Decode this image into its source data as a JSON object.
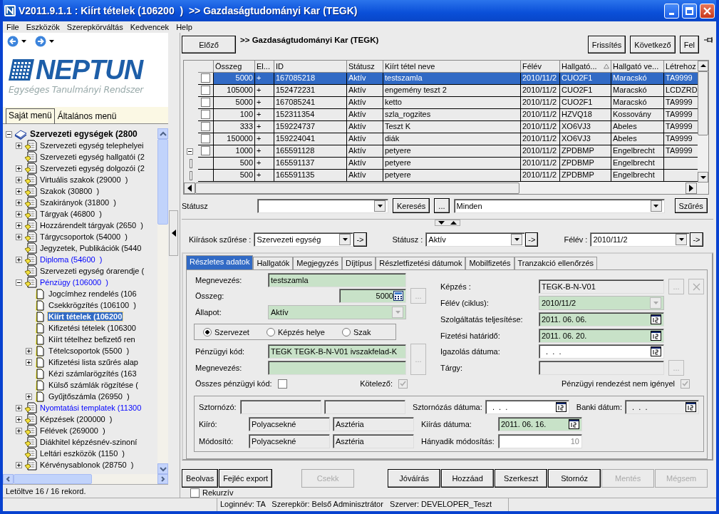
{
  "window": {
    "title": "V2011.9.1.1 : Kiírt tételek (106200  )  >> Gazdaságtudományi Kar (TEGK)"
  },
  "menu": [
    "File",
    "Eszközök",
    "Szerepkörváltás",
    "Kedvencek",
    "Help"
  ],
  "logo": {
    "name": "NEPTUN",
    "subtitle": "Egységes Tanulmányi Rendszer"
  },
  "side_tabs": [
    {
      "label": "Saját menü",
      "selected": true
    },
    {
      "label": "Általános menü",
      "selected": false
    }
  ],
  "tree": [
    {
      "label": "Szervezeti egységek (2800",
      "linked": false,
      "selected": false,
      "expanded": true,
      "children": [
        {
          "label": "Szervezeti egység telephelyei",
          "linked": false,
          "selected": false,
          "expanded": false
        },
        {
          "label": "Szervezeti egység hallgatói (2",
          "linked": false,
          "selected": false
        },
        {
          "label": "Szervezeti egység dolgozói (2",
          "linked": false,
          "selected": false,
          "expanded": false
        },
        {
          "label": "Virtuális szakok (29000  )",
          "linked": false,
          "selected": false,
          "expanded": false
        },
        {
          "label": "Szakok (30800  )",
          "linked": false,
          "selected": false,
          "expanded": false
        },
        {
          "label": "Szakirányok (31800  )",
          "linked": false,
          "selected": false,
          "expanded": false
        },
        {
          "label": "Tárgyak (46800  )",
          "linked": false,
          "selected": false,
          "expanded": false
        },
        {
          "label": "Hozzárendelt tárgyak (2650  )",
          "linked": false,
          "selected": false,
          "expanded": false
        },
        {
          "label": "Tárgycsoportok (54000  )",
          "linked": false,
          "selected": false,
          "expanded": false
        },
        {
          "label": "Jegyzetek, Publikációk (5440",
          "linked": false,
          "selected": false
        },
        {
          "label": "Diploma (54600  )",
          "linked": true,
          "selected": false,
          "expanded": false
        },
        {
          "label": "Szervezeti egység órarendje (",
          "linked": false,
          "selected": false
        },
        {
          "label": "Pénzügy (106000  )",
          "linked": true,
          "selected": false,
          "expanded": true,
          "children": [
            {
              "label": "Jogcímhez rendelés (106",
              "linked": false,
              "selected": false
            },
            {
              "label": "Csekkrögzítés (106100  )",
              "linked": false,
              "selected": false
            },
            {
              "label": "Kiírt tételek (106200",
              "linked": false,
              "selected": true
            },
            {
              "label": "Kifizetési tételek (106300",
              "linked": false,
              "selected": false
            },
            {
              "label": "Kiírt tételhez befizető ren",
              "linked": false,
              "selected": false
            },
            {
              "label": "Tételcsoportok (5500  )",
              "linked": false,
              "selected": false,
              "expanded": false
            },
            {
              "label": "Kifizetési lista szűrés alap",
              "linked": false,
              "selected": false,
              "expanded": false
            },
            {
              "label": "Kézi számlarögzítés (163",
              "linked": false,
              "selected": false
            },
            {
              "label": "Külső számlák rögzítése (",
              "linked": false,
              "selected": false
            },
            {
              "label": "Gyűjtőszámla (26950  )",
              "linked": false,
              "selected": false,
              "expanded": false
            }
          ]
        },
        {
          "label": "Nyomtatási templatek (11300",
          "linked": true,
          "selected": false,
          "expanded": false
        },
        {
          "label": "Képzések (200000  )",
          "linked": false,
          "selected": false,
          "expanded": false
        },
        {
          "label": "Félévek (269000  )",
          "linked": false,
          "selected": false,
          "expanded": false
        },
        {
          "label": "Diákhitel képzésnév-szinoní",
          "linked": false,
          "selected": false
        },
        {
          "label": "Leltári eszközök (1150  )",
          "linked": false,
          "selected": false
        },
        {
          "label": "Kérvénysablonok (28750  )",
          "linked": false,
          "selected": false,
          "expanded": false
        }
      ]
    }
  ],
  "status_left": "Letöltve 16 / 16 rekord.",
  "toolbar": {
    "prev": "Előző",
    "breadcrumb": ">> Gazdaságtudományi Kar (TEGK)",
    "buttons": [
      "Frissítés",
      "Következő",
      "Fel"
    ]
  },
  "table": {
    "columns": [
      {
        "label": "Összeg",
        "sorted": false
      },
      {
        "label": "El...",
        "sorted": false
      },
      {
        "label": "ID",
        "sorted": false
      },
      {
        "label": "Státusz",
        "sorted": false
      },
      {
        "label": "Kiírt tétel neve",
        "sorted": false
      },
      {
        "label": "Félév",
        "sorted": false
      },
      {
        "label": "Hallgató...",
        "sorted": true
      },
      {
        "label": "Hallgató ve...",
        "sorted": false
      },
      {
        "label": "Létrehoz",
        "sorted": false
      }
    ],
    "rows": [
      {
        "checked": false,
        "selected": true,
        "cells": [
          "5000",
          "+",
          "167085218",
          "Aktív",
          "testszamla",
          "2010/11/2",
          "CUO2F1",
          "Maracskó",
          "TA9999"
        ]
      },
      {
        "checked": false,
        "selected": false,
        "cells": [
          "105000",
          "+",
          "152472231",
          "Aktív",
          "engemény teszt 2",
          "2010/11/2",
          "CUO2F1",
          "Maracskó",
          "LCDZRD"
        ]
      },
      {
        "checked": false,
        "selected": false,
        "cells": [
          "5000",
          "+",
          "167085241",
          "Aktív",
          "ketto",
          "2010/11/2",
          "CUO2F1",
          "Maracskó",
          "TA9999"
        ]
      },
      {
        "checked": false,
        "selected": false,
        "cells": [
          "100",
          "+",
          "152311354",
          "Aktív",
          "szla_rogzites",
          "2010/11/2",
          "HZVQ18",
          "Kossovány",
          "TA9999"
        ]
      },
      {
        "checked": false,
        "selected": false,
        "cells": [
          "333",
          "+",
          "159224737",
          "Aktív",
          "Teszt K",
          "2010/11/2",
          "XO6VJ3",
          "Abeles",
          "TA9999"
        ]
      },
      {
        "checked": false,
        "selected": false,
        "cells": [
          "150000",
          "+",
          "159224041",
          "Aktív",
          "diák",
          "2010/11/2",
          "XO6VJ3",
          "Abeles",
          "TA9999"
        ]
      },
      {
        "checked": false,
        "selected": false,
        "expanded": true,
        "cells": [
          "1000",
          "+",
          "165591128",
          "Aktív",
          "petyere",
          "2010/11/2",
          "ZPDBMP",
          "Engelbrecht",
          "TA9999"
        ],
        "children": [
          {
            "selected": false,
            "cells": [
              "500",
              "+",
              "165591137",
              "Aktív",
              "petyere",
              "2010/11/2",
              "ZPDBMP",
              "Engelbrecht",
              null
            ]
          },
          {
            "selected": false,
            "cells": [
              "500",
              "+",
              "165591135",
              "Aktív",
              "petyere",
              "2010/11/2",
              "ZPDBMP",
              "Engelbrecht",
              null
            ]
          }
        ]
      }
    ]
  },
  "search": {
    "label": "Státusz",
    "search_button": "Keresés",
    "more_button": "...",
    "scope_value": "Minden",
    "filter_button": "Szűrés"
  },
  "filters": [
    {
      "label": "Kiírások szűrése :",
      "value": "Szervezeti egység",
      "go": "->"
    },
    {
      "label": "Státusz :",
      "value": "Aktív",
      "go": "->"
    },
    {
      "label": "Félév :",
      "value": "2010/11/2",
      "go": "->"
    }
  ],
  "tabs": [
    {
      "label": "Részletes adatok",
      "selected": true
    },
    {
      "label": "Hallgatók",
      "selected": false
    },
    {
      "label": "Megjegyzés",
      "selected": false
    },
    {
      "label": "Díjtípus",
      "selected": false
    },
    {
      "label": "Részletfizetési dátumok",
      "selected": false
    },
    {
      "label": "Mobilfizetés",
      "selected": false
    },
    {
      "label": "Tranzakció ellenőrzés",
      "selected": false
    }
  ],
  "form": {
    "left": [
      {
        "kind": "field",
        "label": "Megnevezés:",
        "field": {
          "kind": "text",
          "value": "testszamla",
          "required": true,
          "disabled": false
        }
      },
      {
        "kind": "field",
        "label": "Összeg:",
        "field": {
          "kind": "money",
          "value": "5000",
          "required": true,
          "disabled": false
        },
        "extras": [
          {
            "kind": "dots",
            "label": "...",
            "disabled": true
          }
        ]
      },
      {
        "kind": "field",
        "label": "Állapot:",
        "field": {
          "kind": "combo",
          "value": "Aktív",
          "required": true,
          "disabled": true
        }
      },
      {
        "kind": "radios",
        "options": [
          {
            "label": "Szervezet",
            "selected": true
          },
          {
            "label": "Képzés helye",
            "selected": false
          },
          {
            "label": "Szak",
            "selected": false
          }
        ]
      },
      {
        "kind": "field",
        "label": "Pénzügyi kód:",
        "field": {
          "kind": "text",
          "value": "TEGK TEGK-B-N-V01 ivszakfelad-K",
          "required": true,
          "disabled": false
        },
        "extras": [
          {
            "kind": "tall",
            "label": "...",
            "disabled": true
          }
        ]
      },
      {
        "kind": "field",
        "label": "Megnevezés:",
        "field": {
          "kind": "text",
          "required": true,
          "disabled": false
        }
      },
      {
        "kind": "checks",
        "items": [
          {
            "label": "Összes pénzügyi kód:",
            "checked": false,
            "disabled": false
          },
          {
            "label": "Kötelező:",
            "checked": true,
            "disabled": true
          }
        ]
      }
    ],
    "right": [
      {
        "kind": "field",
        "label": "Képzés :",
        "field": {
          "kind": "text",
          "value": "TEGK-B-N-V01",
          "required": false,
          "disabled": true
        },
        "extras": [
          {
            "kind": "dots",
            "label": "...",
            "disabled": true
          },
          {
            "kind": "clear",
            "disabled": true
          }
        ]
      },
      {
        "kind": "field",
        "label": "Félév (ciklus):",
        "field": {
          "kind": "combo",
          "value": "2010/11/2",
          "required": true,
          "disabled": true
        }
      },
      {
        "kind": "field",
        "label": "Szolgáltatás teljesítése:",
        "field": {
          "kind": "date",
          "value": "2011. 06. 06.",
          "required": true,
          "disabled": false
        }
      },
      {
        "kind": "field",
        "label": "Fizetési határidő:",
        "field": {
          "kind": "date",
          "value": "2011. 06. 20.",
          "required": true,
          "disabled": false
        }
      },
      {
        "kind": "field",
        "label": "Igazolás dátuma:",
        "field": {
          "kind": "date",
          "value": "  .  .  .",
          "required": false,
          "disabled": false
        }
      },
      {
        "kind": "field",
        "label": "Tárgy:",
        "field": {
          "kind": "text",
          "required": false,
          "disabled": true
        },
        "extras": [
          {
            "kind": "dots",
            "label": "...",
            "disabled": true
          }
        ]
      },
      {
        "kind": "checks",
        "items": [
          {
            "label": "Pénzügyi rendezést nem igényel",
            "checked": true,
            "disabled": true
          }
        ]
      }
    ],
    "audit": [
      {
        "label": "Sztornózó:",
        "fields": [
          {
            "kind": "text",
            "required": false,
            "disabled": true
          },
          {
            "kind": "text",
            "required": false,
            "disabled": true
          }
        ],
        "pairs": [
          {
            "label": "Sztornózás dátuma:",
            "field": {
              "kind": "date",
              "value": "  .  .  .",
              "required": false,
              "disabled": false
            }
          },
          {
            "label": "Banki dátum:",
            "field": {
              "kind": "date",
              "value": "  .  .  .",
              "required": false,
              "disabled": true
            }
          }
        ]
      },
      {
        "label": "Kiíró:",
        "fields": [
          {
            "kind": "text",
            "value": "Polyacsekné",
            "required": false,
            "disabled": true
          },
          {
            "kind": "text",
            "value": "Asztéria",
            "required": false,
            "disabled": true
          }
        ],
        "pairs": [
          {
            "label": "Kiírás dátuma:",
            "field": {
              "kind": "date",
              "value": "2011. 06. 16.",
              "required": true,
              "disabled": false
            }
          }
        ]
      },
      {
        "label": "Módosító:",
        "fields": [
          {
            "kind": "text",
            "value": "Polyacsekné",
            "required": false,
            "disabled": true
          },
          {
            "kind": "text",
            "value": "Asztéria",
            "required": false,
            "disabled": true
          }
        ],
        "pairs": [
          {
            "label": "Hányadik módosítás:",
            "field": {
              "kind": "number",
              "value": "10",
              "required": false,
              "disabled": false,
              "readonly": true
            }
          }
        ]
      }
    ]
  },
  "actions": [
    {
      "label": "Beolvas",
      "disabled": false
    },
    {
      "label": "Fejléc export",
      "disabled": false
    },
    {
      "label": "Csekk",
      "disabled": true
    },
    {
      "label": "Jóváírás",
      "disabled": false
    },
    {
      "label": "Hozzáad",
      "disabled": false
    },
    {
      "label": "Szerkeszt",
      "disabled": false
    },
    {
      "label": "Stornóz",
      "disabled": false
    },
    {
      "label": "Mentés",
      "disabled": true
    },
    {
      "label": "Mégsem",
      "disabled": true
    }
  ],
  "recursive": {
    "label": "Rekurzív",
    "checked": false
  },
  "status_bar": {
    "session": "Loginnév: TA   Szerepkör: Belső Adminisztrátor   Szerver: DEVELOPER_Teszt"
  }
}
